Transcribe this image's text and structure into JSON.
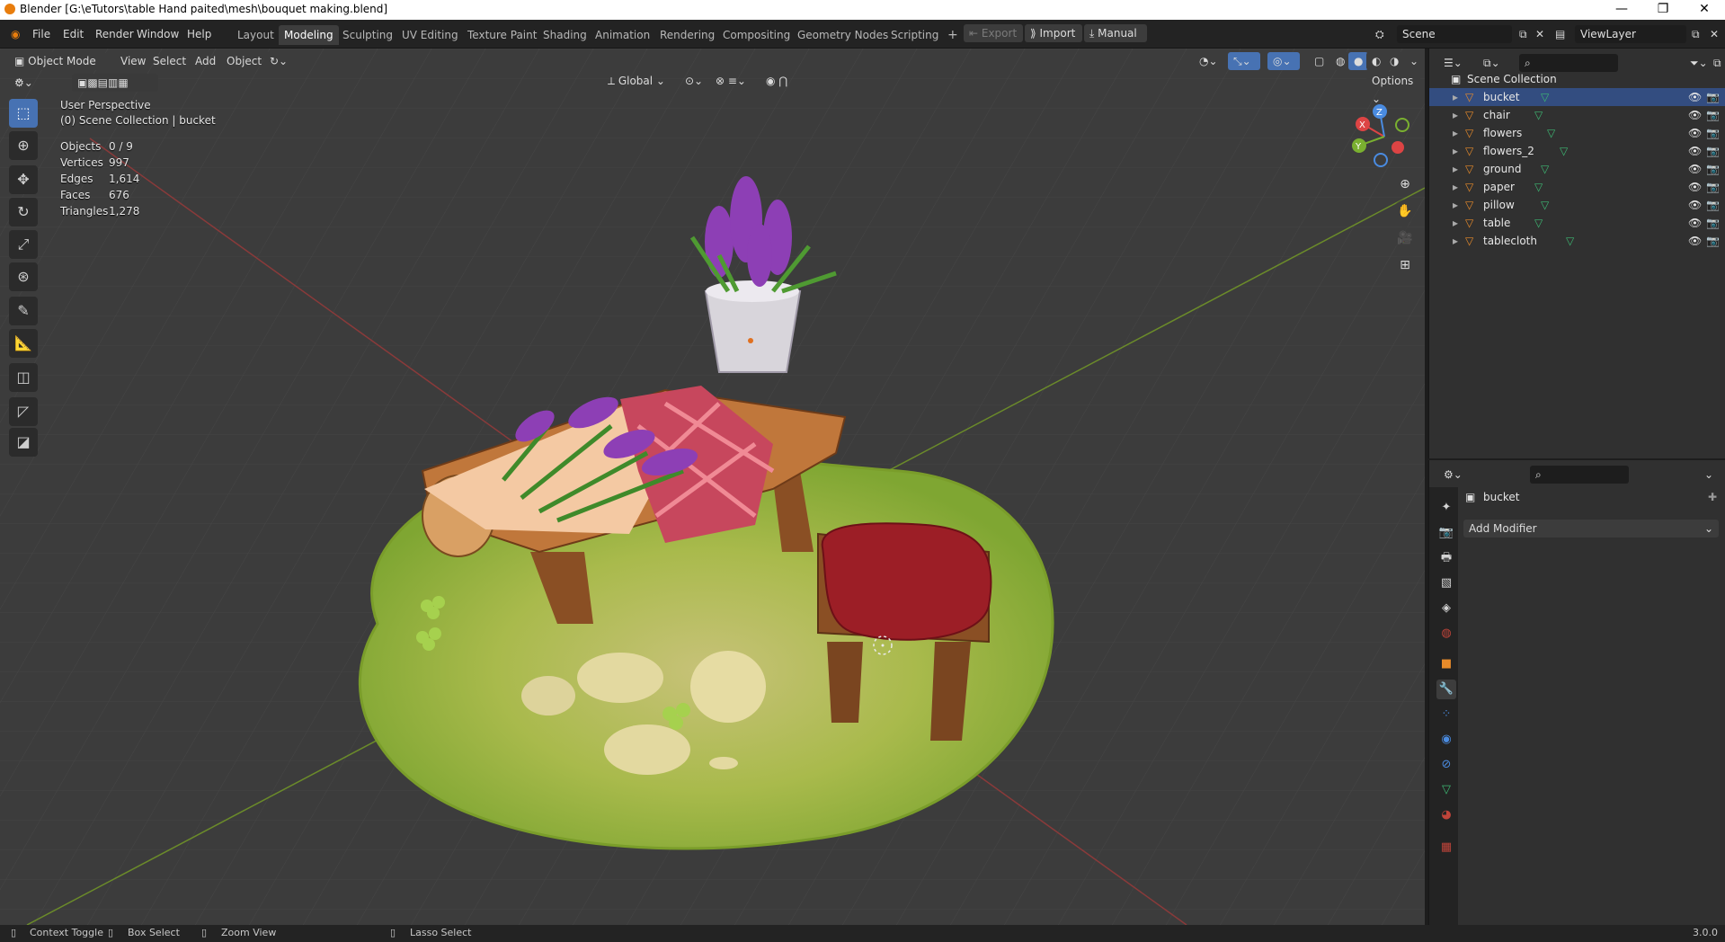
{
  "window": {
    "title": "Blender [G:\\eTutors\\table Hand paited\\mesh\\bouquet making.blend]",
    "min": "—",
    "max": "❐",
    "close": "✕"
  },
  "menus": [
    "File",
    "Edit",
    "Render",
    "Window",
    "Help"
  ],
  "workspaces": [
    "Layout",
    "Modeling",
    "Sculpting",
    "UV Editing",
    "Texture Paint",
    "Shading",
    "Animation",
    "Rendering",
    "Compositing",
    "Geometry Nodes",
    "Scripting"
  ],
  "workspace_add": "+",
  "topbar_buttons": {
    "export": "Export",
    "import": "Import",
    "manual": "Manual"
  },
  "scene": {
    "name": "Scene",
    "viewlayer": "ViewLayer"
  },
  "viewport_header": {
    "mode": "Object Mode",
    "menus": [
      "View",
      "Select",
      "Add",
      "Object"
    ],
    "transform": "Global",
    "options": "Options"
  },
  "overlay": {
    "perspective": "User Perspective",
    "collection": "(0) Scene Collection | bucket"
  },
  "stats": [
    {
      "label": "Objects",
      "value": "0 / 9"
    },
    {
      "label": "Vertices",
      "value": "997"
    },
    {
      "label": "Edges",
      "value": "1,614"
    },
    {
      "label": "Faces",
      "value": "676"
    },
    {
      "label": "Triangles",
      "value": "1,278"
    }
  ],
  "gizmo": {
    "x": "X",
    "y": "Y",
    "z": "Z"
  },
  "outliner": {
    "root": "Scene Collection",
    "items": [
      "bucket",
      "chair",
      "flowers",
      "flowers_2",
      "ground",
      "paper",
      "pillow",
      "table",
      "tablecloth"
    ]
  },
  "properties": {
    "object": "bucket",
    "add_modifier": "Add Modifier"
  },
  "statusbar": {
    "context": "Context Toggle",
    "box": "Box Select",
    "zoom": "Zoom View",
    "lasso": "Lasso Select",
    "version": "3.0.0"
  },
  "colors": {
    "accent": "#4772b3",
    "grid_red": "#9a3b3b",
    "grid_green": "#6a8a2a",
    "ground": "#8cb43a"
  }
}
